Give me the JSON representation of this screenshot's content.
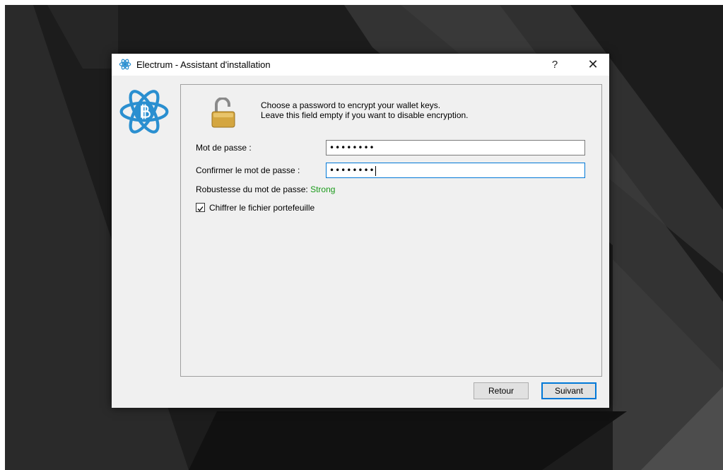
{
  "window": {
    "title": "Electrum  -  Assistant d'installation",
    "help_label": "?",
    "close_label": "✕",
    "app_icon": "electrum-atom-icon"
  },
  "wizard": {
    "intro_line1": "Choose a password to encrypt your wallet keys.",
    "intro_line2": "Leave this field empty if you want to disable encryption.",
    "password_label": "Mot de passe :",
    "password_value": "••••••••",
    "confirm_label": "Confirmer le mot de passe :",
    "confirm_value": "••••••••",
    "strength_label": "Robustesse du mot de passe: ",
    "strength_value": "Strong",
    "encrypt_label": "Chiffrer le fichier portefeuille",
    "encrypt_checked": true
  },
  "buttons": {
    "back_label": "Retour",
    "next_label": "Suivant"
  },
  "colors": {
    "accent": "#0078d7",
    "electrum_blue": "#2a8fd0",
    "strength_green": "#1a9a1a"
  }
}
